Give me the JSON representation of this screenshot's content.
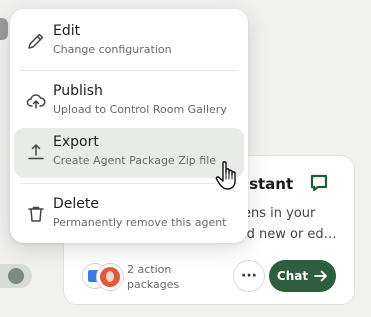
{
  "menu": {
    "items": [
      {
        "title": "Edit",
        "subtitle": "Change configuration",
        "icon": "pencil-icon"
      },
      {
        "title": "Publish",
        "subtitle": "Upload to Control Room Gallery",
        "icon": "cloud-upload-icon"
      },
      {
        "title": "Export",
        "subtitle": "Create Agent Package Zip file",
        "icon": "upload-icon"
      },
      {
        "title": "Delete",
        "subtitle": "Permanently remove this agent",
        "icon": "trash-icon"
      }
    ]
  },
  "agent_card": {
    "title_fragment": "sistant",
    "description_line1": "ens in your",
    "description_line2": "ld new or ed…",
    "packages_line1": "2 action",
    "packages_line2": "packages",
    "more_label": "···",
    "chat_label": "Chat"
  },
  "colors": {
    "accent": "#2f5e3f",
    "hover": "#e9ebe8",
    "background": "#f1f1ef"
  }
}
